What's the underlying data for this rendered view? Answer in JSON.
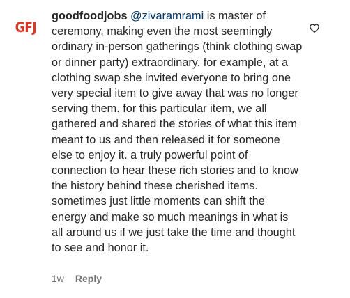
{
  "comment": {
    "avatar_icon": "goodfoodjobs-logo-icon",
    "avatar_text": "GFJ",
    "username": "goodfoodjobs",
    "mention": "@zivaramrami",
    "text": " is master of ceremony, making even the most seemingly ordinary in-person gatherings (think clothing swap or dinner party) extraordinary. for example, at a clothing swap she invited everyone to bring one very special item to give away that was no longer serving them. for this particular item, we all gathered and shared the stories of what this item meant to us and then released it for someone else to enjoy it. a truly powerful point of connection to hear these rich stories and to know the history behind these cherished items. sometimes just little moments can shift the energy and make so much meanings in what is all around us if we just take the time and thought to see and honor it.",
    "timestamp": "1w",
    "reply_label": "Reply",
    "like_icon": "heart-outline-icon"
  },
  "colors": {
    "text": "#262626",
    "mention": "#00376b",
    "meta": "#737373",
    "brand": "#d83a2a"
  }
}
